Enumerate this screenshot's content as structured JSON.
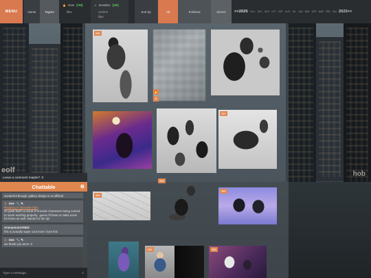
{
  "topbar": {
    "menu_label": "MENU",
    "home_label": "Home",
    "tagme_label": "Tagme",
    "filter_gore": {
      "label": "Gore",
      "state": "[ON]",
      "sub": "filter"
    },
    "filter_sensitive": {
      "label": "Sensitive",
      "state": "[ON]",
      "sub": "content",
      "sub2": "filter"
    },
    "sort_label": "Sort by:",
    "sort_options": [
      "All",
      "Polished",
      "Sketch"
    ],
    "sort_selected": "All",
    "timeline": {
      "start_year": ">>2025",
      "months": [
        "FULL",
        "DEC",
        "NOV",
        "OCT",
        "SEP",
        "AUG",
        "JUL",
        "JUN",
        "MAY",
        "APR",
        "MAR",
        "FEB",
        "JAN"
      ],
      "end_year": "2023<<"
    }
  },
  "gallery": {
    "tag_label": "Set",
    "warning_flame": "🔥",
    "warning_triangle": "⚠"
  },
  "chat": {
    "prompt": "Leave a comment maybe? :3",
    "title": "Chattable",
    "messages": [
      {
        "text": "wonderful though, gallery design is so difficult"
      },
      {
        "author": "Dee",
        "badges": "🔧 ✎",
        "quote": "Replying to @zackbrrrtten",
        "text": "oh yeah that's a result of unicode characters being cursed to never working properly.. guess i'll have to make icons for those as well. thanks for the tip!"
      },
      {
        "author": "Anonymous#0632",
        "text": "this is actually super cool more i love this"
      },
      {
        "author": "Dee",
        "badges": "🔧 ✎",
        "text": "aw thank you anon :3"
      }
    ],
    "input_placeholder": "Type a message...",
    "smiley": "☺"
  },
  "backdrop": {
    "sign_left": "eolf",
    "sign_right": "hob"
  }
}
